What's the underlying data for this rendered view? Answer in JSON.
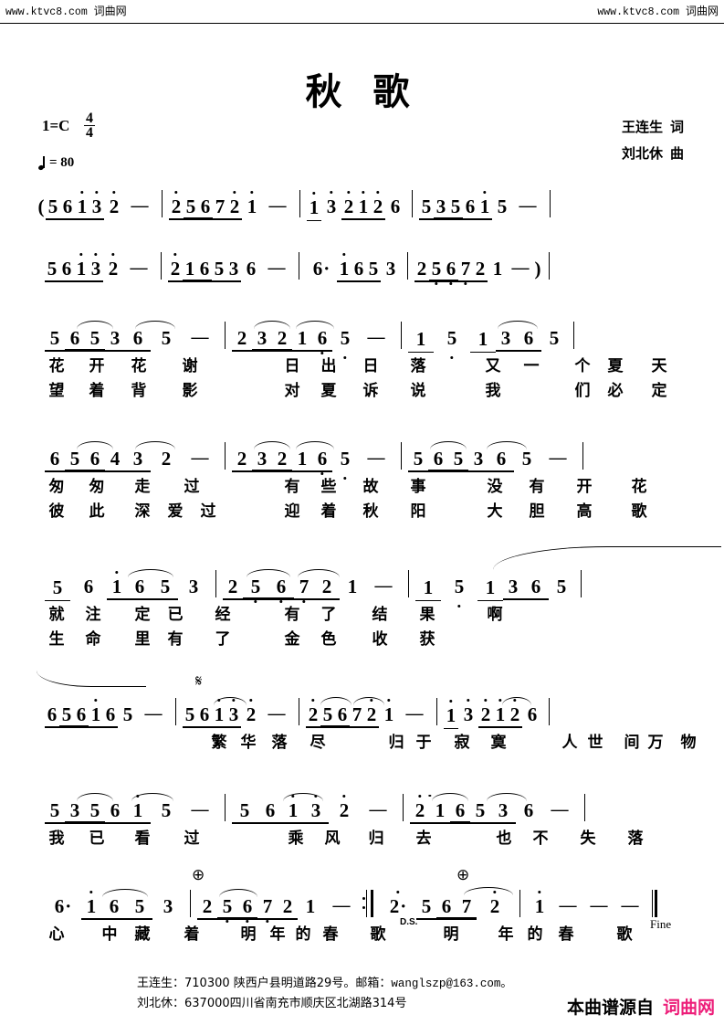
{
  "watermark": {
    "left_url": "www.ktvc8.com",
    "left_cn": "词曲网",
    "right_url": "www.ktvc8.com",
    "right_cn": "词曲网"
  },
  "header": {
    "title": "秋 歌",
    "lyricist": "王连生",
    "lyricist_role": "词",
    "composer": "刘北休",
    "composer_role": "曲",
    "key_signature": "1=C",
    "time_numerator": "4",
    "time_denominator": "4",
    "tempo_value": "= 80"
  },
  "symbols": {
    "segno": "𝄋",
    "coda": "⊕",
    "ds": "D.S.",
    "fine": "Fine",
    "open_paren": "(",
    "close_paren": ")",
    "dash": "—",
    "dot": "·"
  },
  "colors": {
    "ink": "#000000",
    "brand_pink": "#ED1E79"
  },
  "score": {
    "lines": [
      {
        "id": "line-1",
        "measures": [
          {
            "notes": [
              "(5",
              "6",
              "1",
              "3",
              "2",
              "—"
            ]
          },
          {
            "notes": [
              "2",
              "5",
              "6",
              "7",
              "2",
              "1",
              "—"
            ]
          },
          {
            "notes": [
              "1",
              "3",
              "2",
              "1",
              "2",
              "6"
            ]
          },
          {
            "notes": [
              "5",
              "3",
              "5",
              "6",
              "1",
              "5",
              "—"
            ]
          }
        ]
      },
      {
        "id": "line-2",
        "measures": [
          {
            "notes": [
              "5",
              "6",
              "1",
              "3",
              "2",
              "—"
            ]
          },
          {
            "notes": [
              "2",
              "1",
              "6",
              "5",
              "3",
              "6",
              "—"
            ]
          },
          {
            "notes": [
              "6·",
              "1",
              "6",
              "5",
              "3"
            ]
          },
          {
            "notes": [
              "2",
              "5",
              "6",
              "7",
              "2",
              "1",
              "—",
              ")"
            ]
          }
        ]
      },
      {
        "id": "line-3",
        "measures": [
          {
            "notes": [
              "5",
              "6",
              "5",
              "3",
              "6",
              "5",
              "—"
            ]
          },
          {
            "notes": [
              "2",
              "3",
              "2",
              "1",
              "6",
              "5",
              "—"
            ]
          },
          {
            "notes": [
              "1",
              "5",
              "1",
              "3",
              "6",
              "5"
            ]
          }
        ],
        "lyrics_1": [
          "花",
          "开",
          "花",
          "谢",
          "日",
          "出",
          "日",
          "落",
          "又",
          "一",
          "个",
          "夏",
          "天"
        ],
        "lyrics_2": [
          "望",
          "着",
          "背",
          "影",
          "对",
          "夏",
          "诉",
          "说",
          "我",
          "们",
          "必",
          "定"
        ]
      },
      {
        "id": "line-4",
        "measures": [
          {
            "notes": [
              "6",
              "5",
              "6",
              "4",
              "3",
              "2",
              "—"
            ]
          },
          {
            "notes": [
              "2",
              "3",
              "2",
              "1",
              "6",
              "5",
              "—"
            ]
          },
          {
            "notes": [
              "5",
              "6",
              "5",
              "3",
              "6",
              "5",
              "—"
            ]
          }
        ],
        "lyrics_1": [
          "匆",
          "匆",
          "走",
          "过",
          "有",
          "些",
          "故",
          "事",
          "没",
          "有",
          "开",
          "花"
        ],
        "lyrics_2": [
          "彼",
          "此",
          "深",
          "爱",
          "过",
          "迎",
          "着",
          "秋",
          "阳",
          "大",
          "胆",
          "高",
          "歌"
        ]
      },
      {
        "id": "line-5",
        "measures": [
          {
            "notes": [
              "5",
              "6",
              "1",
              "6",
              "5",
              "3"
            ]
          },
          {
            "notes": [
              "2",
              "5",
              "6",
              "7",
              "2",
              "1",
              "—"
            ]
          },
          {
            "notes": [
              "1",
              "5",
              "1",
              "3",
              "6",
              "5"
            ]
          }
        ],
        "lyrics_1": [
          "就",
          "注",
          "定",
          "已",
          "经",
          "有",
          "了",
          "结",
          "果",
          "啊"
        ],
        "lyrics_2": [
          "生",
          "命",
          "里",
          "有",
          "了",
          "金",
          "色",
          "收",
          "获"
        ]
      },
      {
        "id": "line-6",
        "measures": [
          {
            "notes": [
              "6",
              "5",
              "6",
              "1",
              "6",
              "5",
              "—"
            ]
          },
          {
            "notes": [
              "5",
              "6",
              "1",
              "3",
              "2",
              "—"
            ]
          },
          {
            "notes": [
              "2",
              "5",
              "6",
              "7",
              "2",
              "1",
              "—"
            ]
          },
          {
            "notes": [
              "1",
              "3",
              "2",
              "1",
              "2",
              "6"
            ]
          }
        ],
        "lyrics_1": [
          "繁",
          "华",
          "落",
          "尽",
          "归",
          "于",
          "寂",
          "寞",
          "人",
          "世",
          "间",
          "万",
          "物"
        ]
      },
      {
        "id": "line-7",
        "measures": [
          {
            "notes": [
              "5",
              "3",
              "5",
              "6",
              "1",
              "5",
              "—"
            ]
          },
          {
            "notes": [
              "5",
              "6",
              "1",
              "3",
              "2",
              "—"
            ]
          },
          {
            "notes": [
              "2",
              "1",
              "6",
              "5",
              "3",
              "6",
              "—"
            ]
          }
        ],
        "lyrics_1": [
          "我",
          "已",
          "看",
          "过",
          "乘",
          "风",
          "归",
          "去",
          "也",
          "不",
          "失",
          "落"
        ]
      },
      {
        "id": "line-8",
        "measures": [
          {
            "notes": [
              "6·",
              "1",
              "6",
              "5",
              "3"
            ]
          },
          {
            "notes": [
              "2",
              "5",
              "6",
              "7",
              "2",
              "1",
              "—"
            ]
          },
          {
            "notes": [
              "2·",
              "5",
              "6",
              "7",
              "2"
            ]
          },
          {
            "notes": [
              "1",
              "—",
              "—",
              "—"
            ]
          }
        ],
        "lyrics_1": [
          "心",
          "中",
          "藏",
          "着",
          "明",
          "年",
          "的",
          "春",
          "歌",
          "明",
          "年",
          "的",
          "春",
          "歌"
        ]
      }
    ]
  },
  "footer": {
    "line1_prefix": "王连生：",
    "line1_text": "710300    陕西户县明道路29号。邮箱：",
    "line1_email": "wanglszp@163.com。",
    "line2_prefix": "刘北休：",
    "line2_text": "637000四川省南充市顺庆区北湖路314号",
    "source_text": "本曲谱源自",
    "source_brand": "词曲网"
  }
}
